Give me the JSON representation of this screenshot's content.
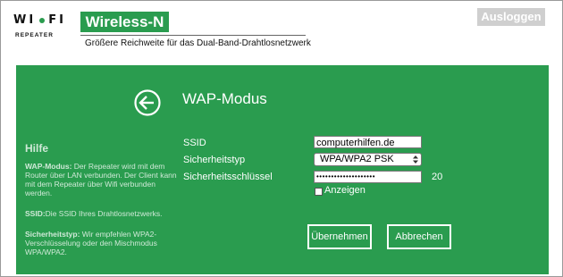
{
  "header": {
    "logo_text_left": "WI",
    "logo_text_right": "FI",
    "logo_subtext": "REPEATER",
    "brand": "Wireless-N",
    "subtitle": "Größere Reichweite für das Dual-Band-Drahtlosnetzwerk",
    "logout_label": "Ausloggen"
  },
  "main": {
    "heading": "WAP-Modus",
    "back_icon": "back-arrow-circle-icon"
  },
  "help": {
    "title": "Hilfe",
    "items": [
      {
        "term": "WAP-Modus:",
        "text": " Der Repeater wird mit dem Router über LAN verbunden. Der Client kann mit dem Repeater über Wifi verbunden werden."
      },
      {
        "term": "SSID:",
        "text": "Die SSID Ihres Drahtlosnetzwerks."
      },
      {
        "term": "Sicherheitstyp:",
        "text": " Wir empfehlen WPA2-Verschlüsselung oder den Mischmodus WPA/WPA2."
      }
    ]
  },
  "form": {
    "ssid_label": "SSID",
    "ssid_value": "computerhilfen.de",
    "security_type_label": "Sicherheitstyp",
    "security_type_value": "WPA/WPA2  PSK",
    "security_key_label": "Sicherheitsschlüssel",
    "security_key_value": "••••••••••••••••••••",
    "security_key_length": "20",
    "show_label": "Anzeigen",
    "show_checked": false
  },
  "buttons": {
    "apply": "Übernehmen",
    "cancel": "Abbrechen"
  },
  "colors": {
    "brand_green": "#2a9c4f",
    "help_text": "#cfe9d7",
    "logout_bg": "#cfcfcf"
  }
}
